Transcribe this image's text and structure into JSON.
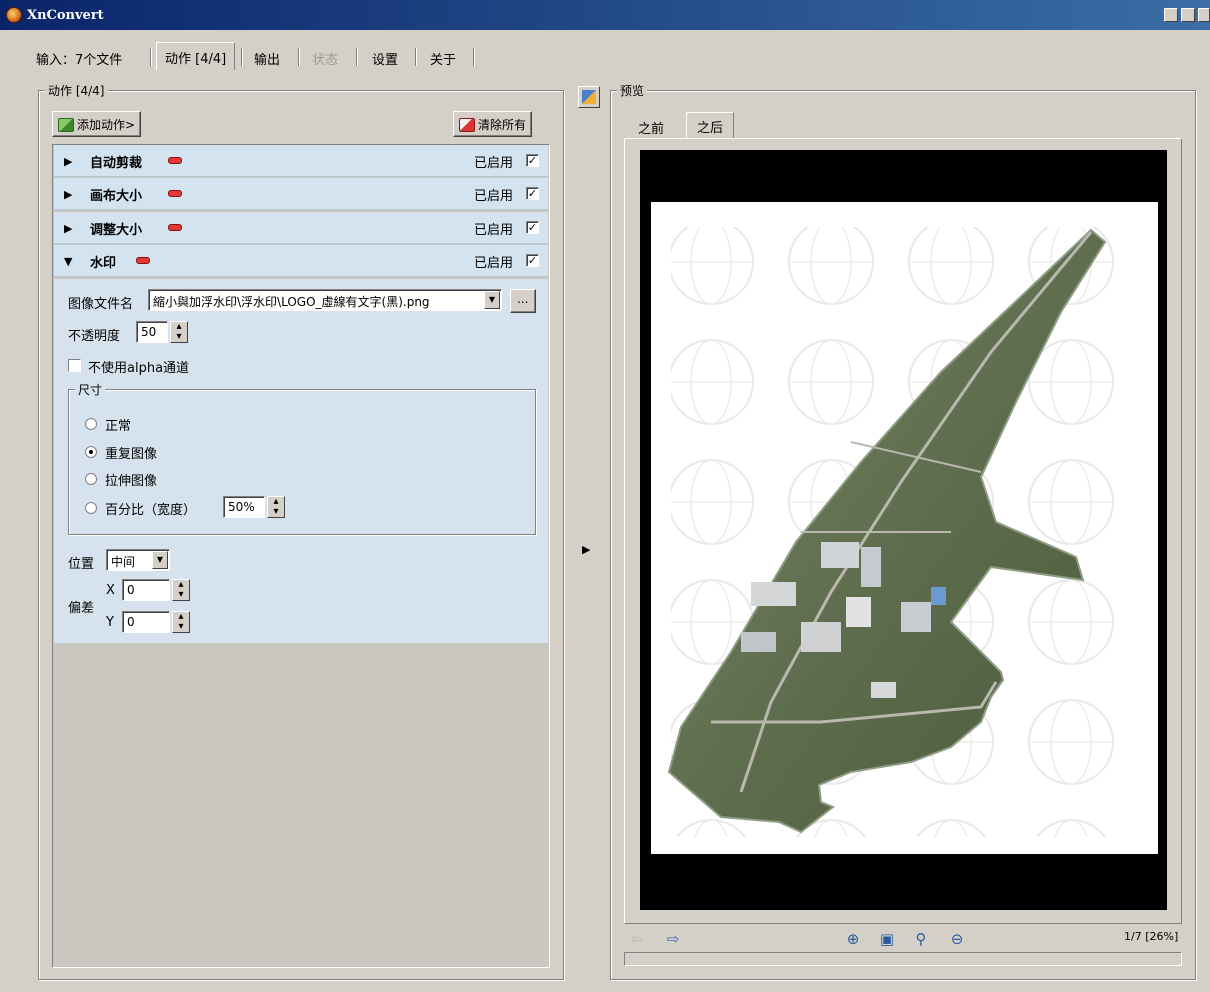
{
  "window": {
    "title": "XnConvert"
  },
  "tabs": [
    {
      "label": "输入：7个文件"
    },
    {
      "label": "动作 [4/4]"
    },
    {
      "label": "输出"
    },
    {
      "label": "状态"
    },
    {
      "label": "设置"
    },
    {
      "label": "关于"
    }
  ],
  "actions_panel": {
    "title": "动作 [4/4]",
    "add_button": "添加动作>",
    "clear_button": "清除所有",
    "items": [
      {
        "name": "自动剪裁",
        "enabled_label": "已启用",
        "enabled": true
      },
      {
        "name": "画布大小",
        "enabled_label": "已启用",
        "enabled": true
      },
      {
        "name": "调整大小",
        "enabled_label": "已启用",
        "enabled": true
      },
      {
        "name": "水印",
        "enabled_label": "已启用",
        "enabled": true
      }
    ]
  },
  "watermark": {
    "file_label": "图像文件名",
    "file_value": "縮小與加浮水印\\浮水印\\LOGO_虛線有文字(黑).png",
    "browse_label": "...",
    "opacity_label": "不透明度",
    "opacity_value": "50",
    "no_alpha_label": "不使用alpha通道",
    "size_group_title": "尺寸",
    "size_options": [
      "正常",
      "重复图像",
      "拉伸图像",
      "百分比（宽度）"
    ],
    "size_selected": "重复图像",
    "percent_value": "50%",
    "position_label": "位置",
    "position_value": "中间",
    "offset_label": "偏差",
    "x_label": "X",
    "x_value": "0",
    "y_label": "Y",
    "y_value": "0"
  },
  "preview": {
    "title": "预览",
    "tab_before": "之前",
    "tab_after": "之后",
    "page_info": "1/7 [26%]"
  },
  "icons": {
    "expand": "right-triangle",
    "nav_prev": "left-arrow",
    "nav_next": "right-arrow",
    "zoom_in": "zoom-in",
    "fit": "fit-to-window",
    "zoom_actual": "magnifier",
    "zoom_out": "zoom-out"
  }
}
